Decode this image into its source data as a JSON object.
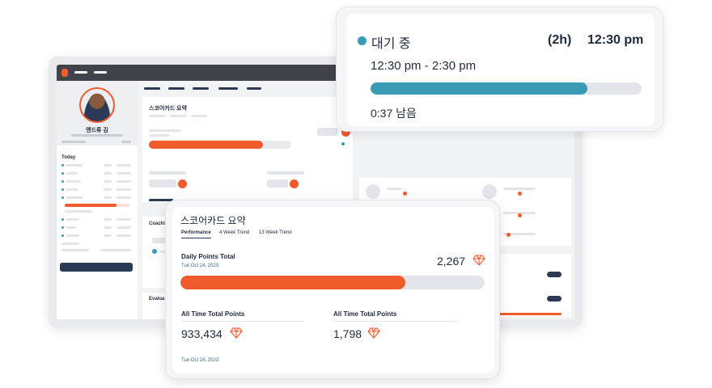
{
  "colors": {
    "accent_orange": "#f15a2b",
    "accent_teal": "#3b9bb5",
    "navy": "#2b3a55",
    "track_gray": "#e3e5ea"
  },
  "background_app": {
    "profile": {
      "name": "앤드류 김",
      "avatar": "profile-photo"
    },
    "sidebar": {
      "today_label": "Today"
    },
    "scorecard_mini": {
      "title": "스코어카드 요약",
      "progress_fraction": 0.8
    },
    "coaching_label": "Coachi",
    "evaluation_label": "Evalua"
  },
  "appointment": {
    "status": "대기 중",
    "duration": "(2h)",
    "start_time": "12:30 pm",
    "time_range": "12:30 pm - 2:30 pm",
    "progress_fraction": 0.8,
    "remaining": "0:37 남음"
  },
  "scorecard": {
    "title": "스코어카드 요약",
    "tabs": [
      {
        "label": "Performance",
        "active": true
      },
      {
        "label": "4 Week Trend",
        "active": false
      },
      {
        "label": "13 Week Trend",
        "active": false
      }
    ],
    "daily": {
      "label": "Daily Points Total",
      "date": "Tue Oct 24, 2023",
      "value": "2,267",
      "progress_fraction": 0.74
    },
    "all_time_left": {
      "label": "All Time Total Points",
      "value": "933,434"
    },
    "all_time_right": {
      "label": "All Time Total Points",
      "value": "1,798"
    },
    "footer_date": "Tue Oct 24, 2023",
    "icon": "gem-icon"
  }
}
